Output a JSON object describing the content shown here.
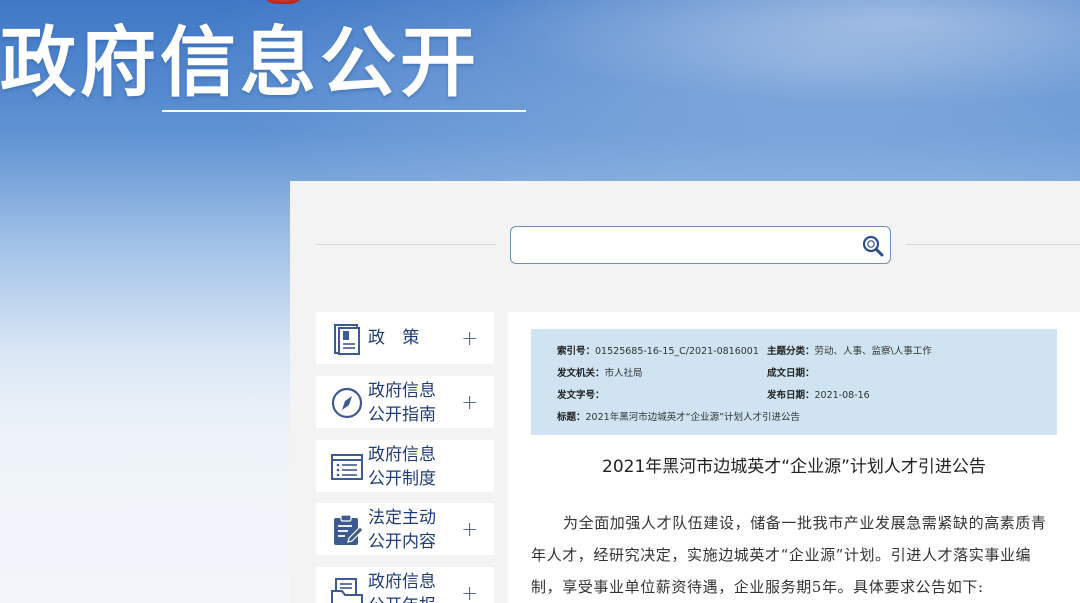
{
  "header": {
    "title": "政府信息公开"
  },
  "search": {
    "placeholder": "",
    "value": ""
  },
  "sidebar": {
    "items": [
      {
        "label": "政  策",
        "icon": "policy-document-icon",
        "expander": "+"
      },
      {
        "label": "政府信息\n公开指南",
        "icon": "compass-icon",
        "expander": "+"
      },
      {
        "label": "政府信息\n公开制度",
        "icon": "list-icon",
        "expander": ""
      },
      {
        "label": "法定主动\n公开内容",
        "icon": "clipboard-edit-icon",
        "expander": "+"
      },
      {
        "label": "政府信息\n公开年报",
        "icon": "report-folder-icon",
        "expander": "+"
      }
    ]
  },
  "meta": {
    "index_label": "索引号：",
    "index_value": "01525685-16-15_C/2021-0816001",
    "topic_label": "主题分类：",
    "topic_value": "劳动、人事、监察\\人事工作",
    "issuer_label": "发文机关：",
    "issuer_value": "市人社局",
    "written_label": "成文日期：",
    "written_value": "",
    "docno_label": "发文字号：",
    "docno_value": "",
    "publish_label": "发布日期：",
    "publish_value": "2021-08-16",
    "subject_label": "标题：",
    "subject_value": "2021年黑河市边城英才“企业源”计划人才引进公告"
  },
  "article": {
    "title": "2021年黑河市边城英才“企业源”计划人才引进公告",
    "body": "为全面加强人才队伍建设，储备一批我市产业发展急需紧缺的高素质青年人才，经研究决定，实施边城英才“企业源”计划。引进人才落实事业编制，享受事业单位薪资待遇，企业服务期5年。具体要求公告如下:"
  },
  "colors": {
    "accent": "#1f3c78",
    "meta_bg": "#cfe3f1",
    "banner_top": "#3f78c6"
  }
}
